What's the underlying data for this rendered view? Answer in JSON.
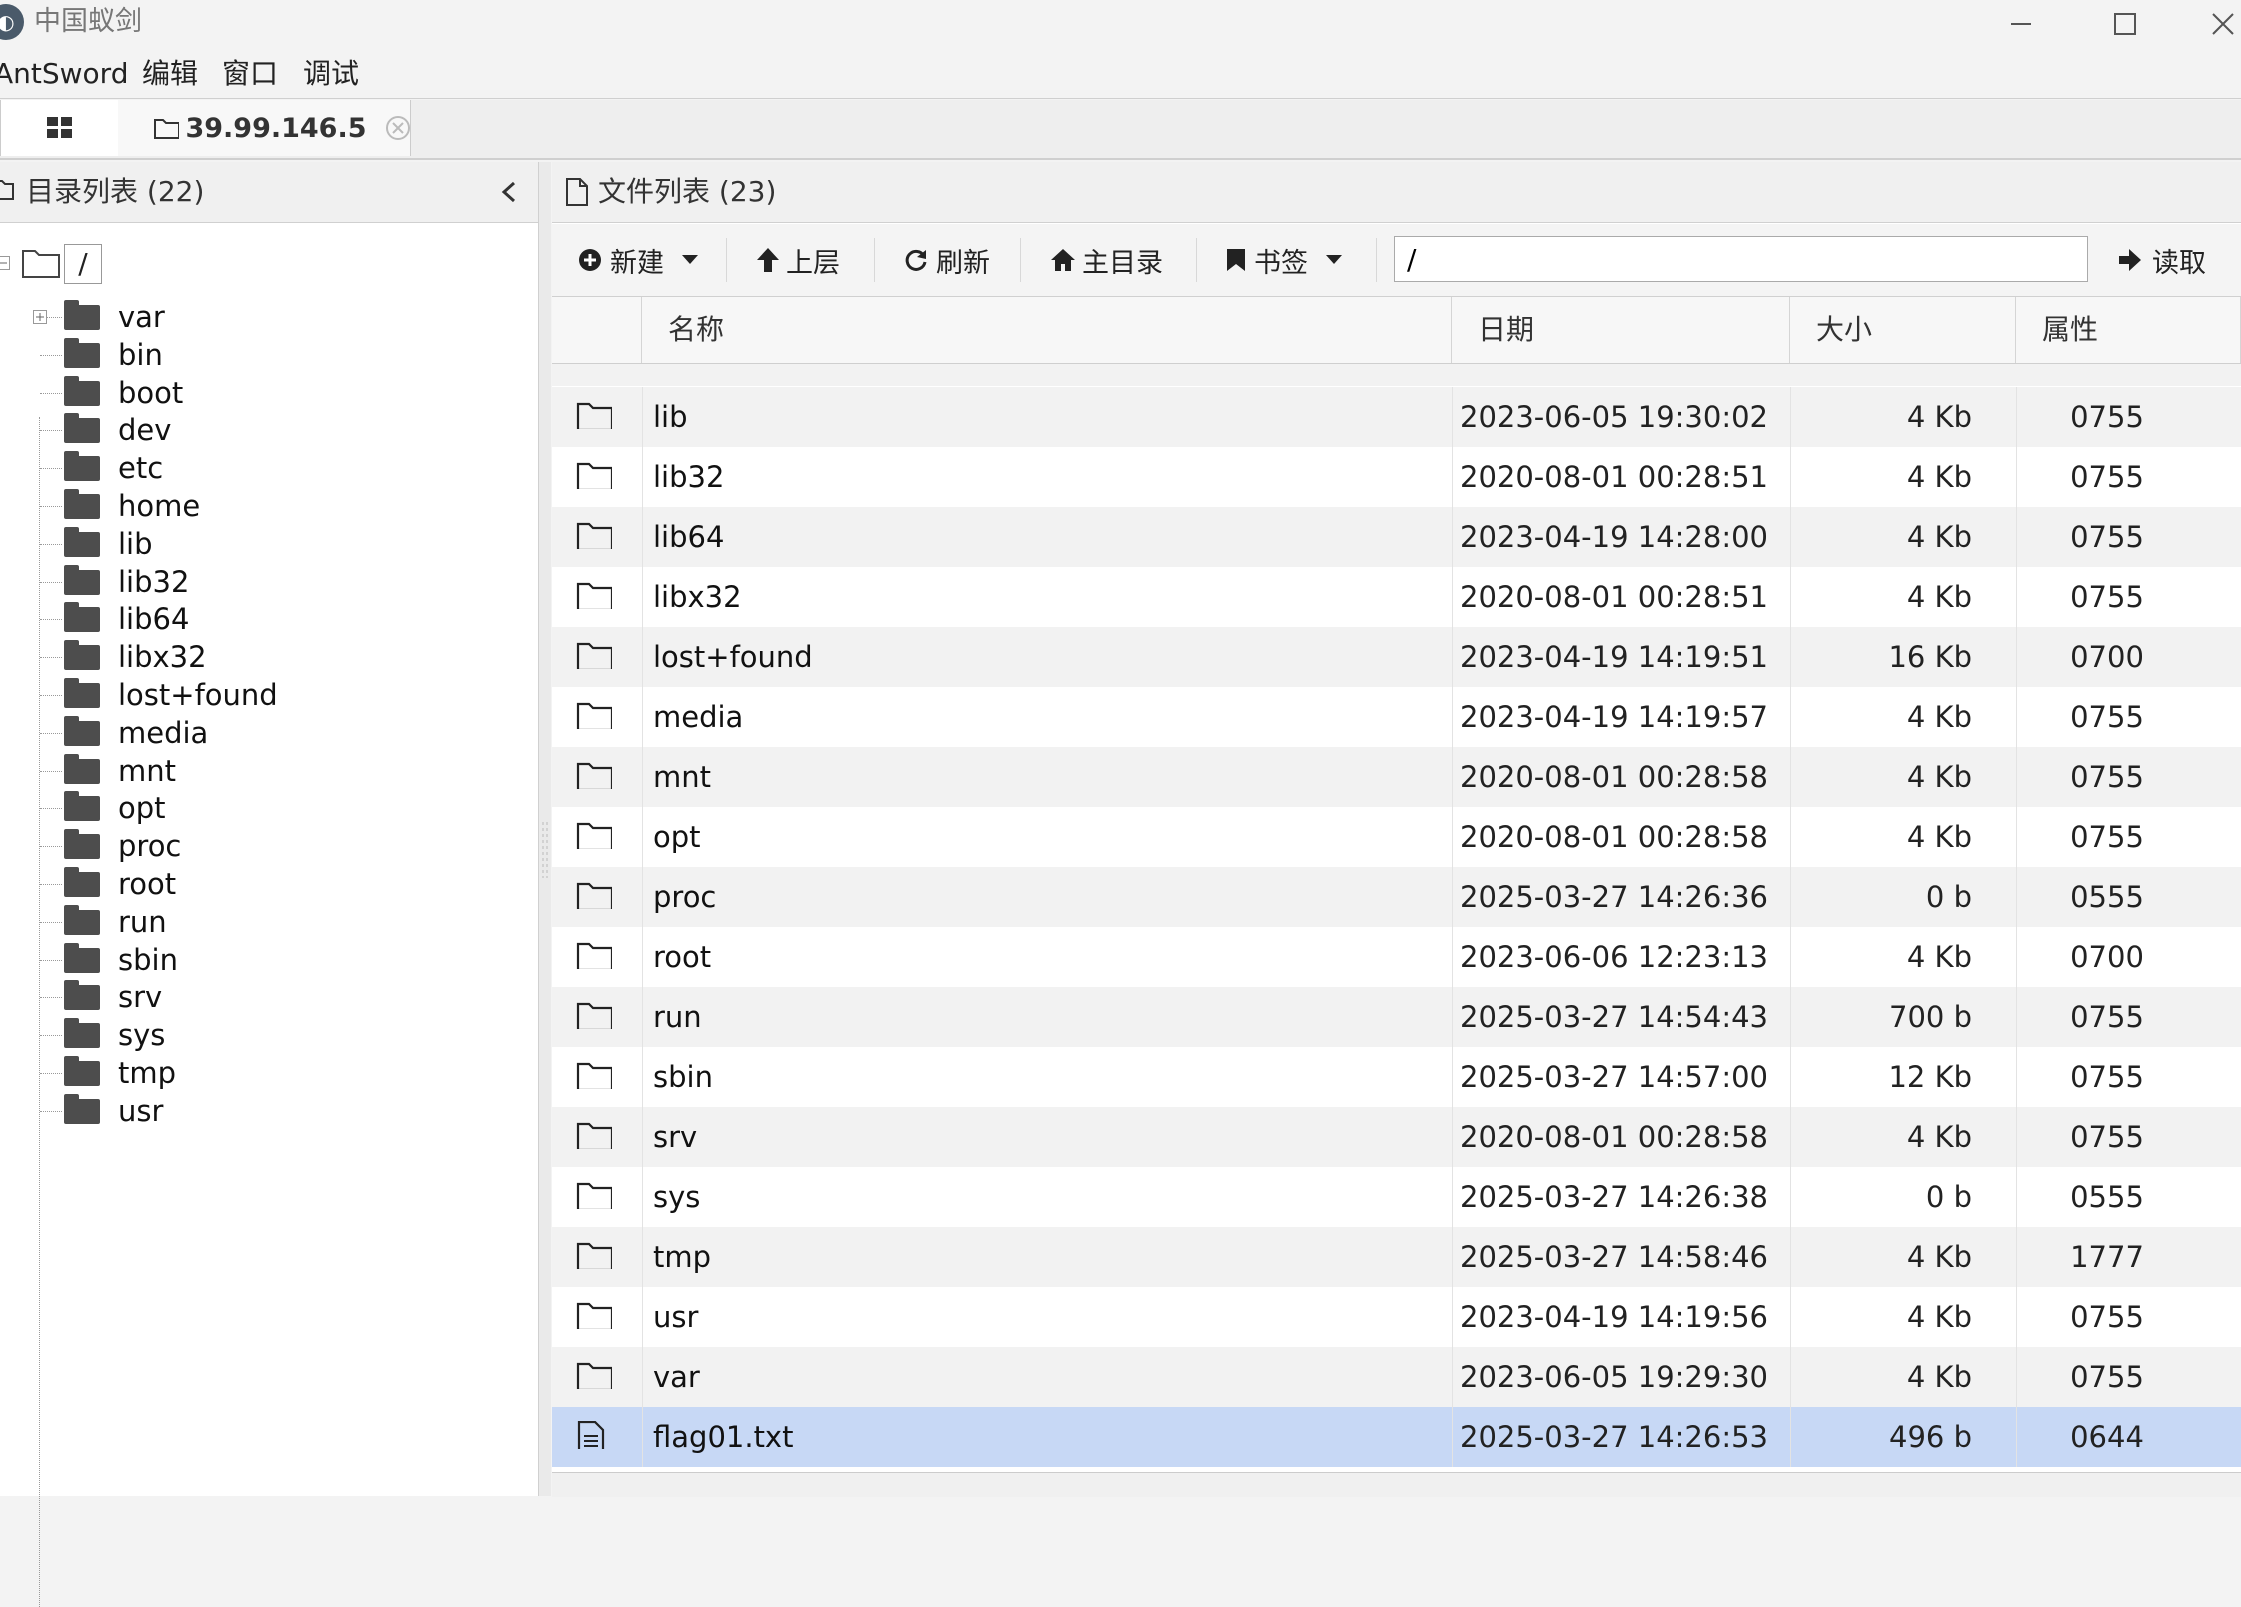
{
  "window": {
    "title": "中国蚁剑",
    "app_icon": "antsword-icon",
    "controls": [
      "minimize-icon",
      "maximize-icon",
      "close-icon"
    ]
  },
  "menu": [
    "AntSword",
    "编辑",
    "窗口",
    "调试"
  ],
  "tabs": {
    "home_icon": "grid-icon",
    "host": "39.99.146.5",
    "host_icon": "folder-outline-icon",
    "close_icon": "close-circle-icon"
  },
  "left_panel": {
    "title": "目录列表 (22)",
    "root": "/",
    "items": [
      "var",
      "bin",
      "boot",
      "dev",
      "etc",
      "home",
      "lib",
      "lib32",
      "lib64",
      "libx32",
      "lost+found",
      "media",
      "mnt",
      "opt",
      "proc",
      "root",
      "run",
      "sbin",
      "srv",
      "sys",
      "tmp",
      "usr"
    ]
  },
  "right_panel": {
    "title": "文件列表 (23)",
    "toolbar": {
      "new": "新建",
      "up": "上层",
      "refresh": "刷新",
      "home": "主目录",
      "bookmark": "书签",
      "path": "/",
      "read": "读取"
    },
    "columns": [
      "名称",
      "日期",
      "大小",
      "属性"
    ],
    "rows": [
      {
        "name": "lib",
        "date": "2023-06-05 19:30:02",
        "size": "4 Kb",
        "attr": "0755",
        "type": "folder"
      },
      {
        "name": "lib32",
        "date": "2020-08-01 00:28:51",
        "size": "4 Kb",
        "attr": "0755",
        "type": "folder"
      },
      {
        "name": "lib64",
        "date": "2023-04-19 14:28:00",
        "size": "4 Kb",
        "attr": "0755",
        "type": "folder"
      },
      {
        "name": "libx32",
        "date": "2020-08-01 00:28:51",
        "size": "4 Kb",
        "attr": "0755",
        "type": "folder"
      },
      {
        "name": "lost+found",
        "date": "2023-04-19 14:19:51",
        "size": "16 Kb",
        "attr": "0700",
        "type": "folder"
      },
      {
        "name": "media",
        "date": "2023-04-19 14:19:57",
        "size": "4 Kb",
        "attr": "0755",
        "type": "folder"
      },
      {
        "name": "mnt",
        "date": "2020-08-01 00:28:58",
        "size": "4 Kb",
        "attr": "0755",
        "type": "folder"
      },
      {
        "name": "opt",
        "date": "2020-08-01 00:28:58",
        "size": "4 Kb",
        "attr": "0755",
        "type": "folder"
      },
      {
        "name": "proc",
        "date": "2025-03-27 14:26:36",
        "size": "0 b",
        "attr": "0555",
        "type": "folder"
      },
      {
        "name": "root",
        "date": "2023-06-06 12:23:13",
        "size": "4 Kb",
        "attr": "0700",
        "type": "folder"
      },
      {
        "name": "run",
        "date": "2025-03-27 14:54:43",
        "size": "700 b",
        "attr": "0755",
        "type": "folder"
      },
      {
        "name": "sbin",
        "date": "2025-03-27 14:57:00",
        "size": "12 Kb",
        "attr": "0755",
        "type": "folder"
      },
      {
        "name": "srv",
        "date": "2020-08-01 00:28:58",
        "size": "4 Kb",
        "attr": "0755",
        "type": "folder"
      },
      {
        "name": "sys",
        "date": "2025-03-27 14:26:38",
        "size": "0 b",
        "attr": "0555",
        "type": "folder"
      },
      {
        "name": "tmp",
        "date": "2025-03-27 14:58:46",
        "size": "4 Kb",
        "attr": "1777",
        "type": "folder"
      },
      {
        "name": "usr",
        "date": "2023-04-19 14:19:56",
        "size": "4 Kb",
        "attr": "0755",
        "type": "folder"
      },
      {
        "name": "var",
        "date": "2023-06-05 19:29:30",
        "size": "4 Kb",
        "attr": "0755",
        "type": "folder"
      },
      {
        "name": "flag01.txt",
        "date": "2025-03-27 14:26:53",
        "size": "496 b",
        "attr": "0644",
        "type": "file",
        "selected": true
      }
    ]
  },
  "colors": {
    "selected_row": "#c7d8f5",
    "alt_row": "#f2f2f2",
    "folder_fill": "#4d4d4d"
  }
}
